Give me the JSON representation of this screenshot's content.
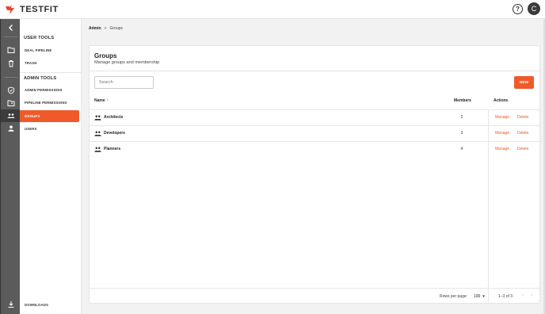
{
  "header": {
    "brand": "TESTFIT",
    "help_icon": "help-circle-icon",
    "avatar_initial": "C",
    "brand_color": "#e8472b"
  },
  "rail": {
    "items": [
      {
        "icon": "chevron-left-icon"
      },
      {
        "icon": "folder-icon"
      },
      {
        "icon": "trash-icon"
      },
      {
        "icon": "shield-icon"
      },
      {
        "icon": "folder-user-icon"
      },
      {
        "icon": "group-icon",
        "active": true
      },
      {
        "icon": "user-icon"
      },
      {
        "icon": "download-icon"
      }
    ]
  },
  "sidenav": {
    "user_tools_title": "USER TOOLS",
    "deal_pipeline": "DEAL PIPELINE",
    "trash": "TRASH",
    "admin_tools_title": "ADMIN TOOLS",
    "admin_permissions": "ADMIN PERMISSIONS",
    "pipeline_permissions": "PIPELINE PERMISSIONS",
    "groups": "GROUPS",
    "users": "USERS",
    "downloads": "DOWNLOADS"
  },
  "breadcrumb": {
    "root": "Admin",
    "separator": ">",
    "current": "Groups"
  },
  "card": {
    "title": "Groups",
    "subtitle": "Manage groups and membership",
    "search_placeholder": "Search",
    "new_label": "NEW",
    "accent_color": "#f05a2a"
  },
  "table": {
    "columns": {
      "name": "Name",
      "name_sort": "↑",
      "members": "Members",
      "actions": "Actions"
    },
    "rows": [
      {
        "name": "Architects",
        "members": "2",
        "manage": "Manage",
        "delete": "Delete"
      },
      {
        "name": "Developers",
        "members": "3",
        "manage": "Manage",
        "delete": "Delete"
      },
      {
        "name": "Planners",
        "members": "4",
        "manage": "Manage",
        "delete": "Delete"
      }
    ]
  },
  "pagination": {
    "rows_per_page_label": "Rows per page:",
    "rows_per_page_value": "100",
    "range": "1–3 of 3",
    "prev": "‹",
    "next": "›"
  }
}
